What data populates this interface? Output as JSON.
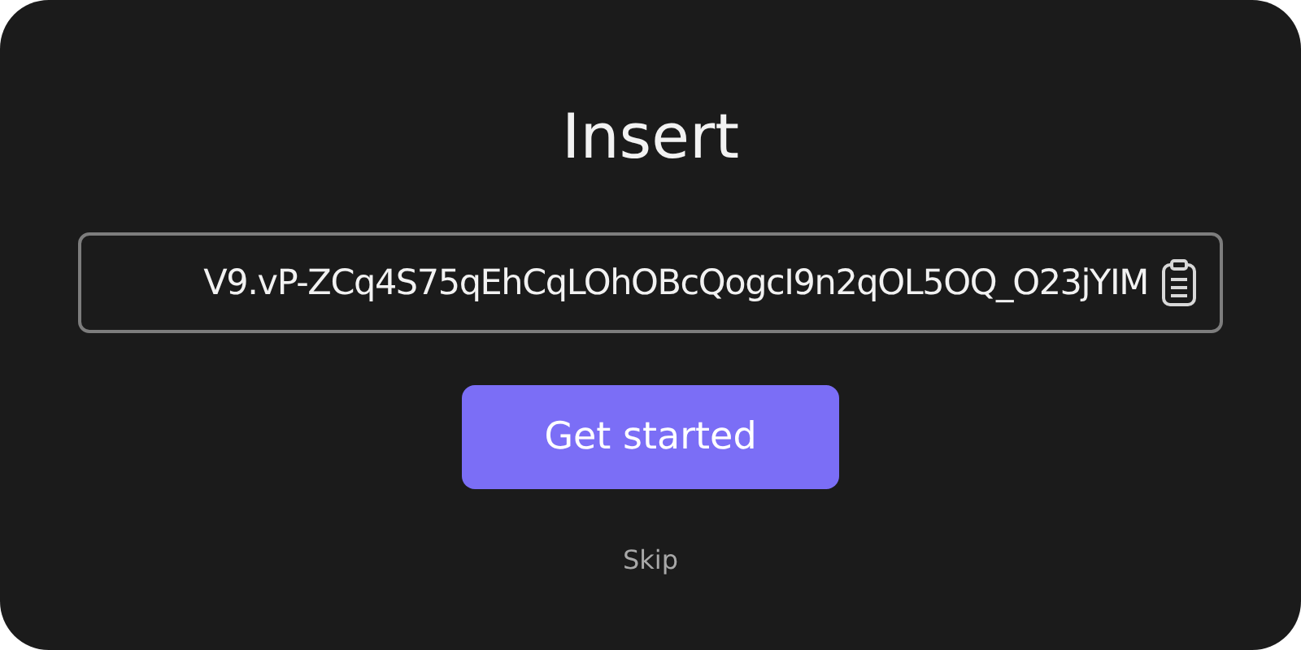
{
  "title": "Insert",
  "token_field": {
    "value": "V9.vP-ZCq4S75qEhCqLOhOBcQogcI9n2qOL5OQ_O23jYIM"
  },
  "primary_button": {
    "label": "Get started"
  },
  "skip_link": {
    "label": "Skip"
  }
}
